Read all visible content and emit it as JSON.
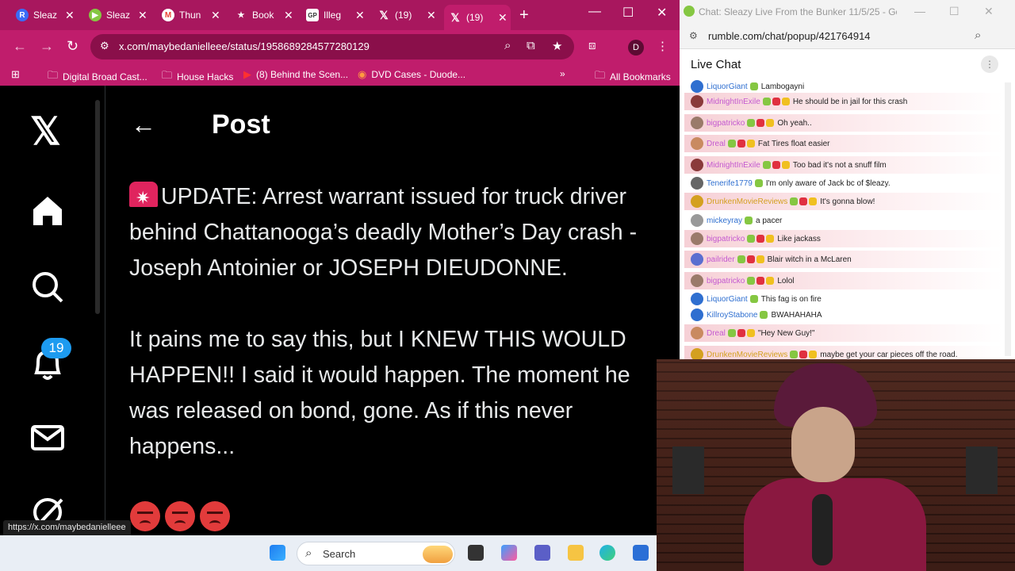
{
  "browser": {
    "tabs": [
      {
        "label": "Sleaz",
        "fav": "R",
        "fav_color": "#3b6cf6"
      },
      {
        "label": "Sleaz",
        "fav": "▶",
        "fav_color": "#85c742"
      },
      {
        "label": "Thun",
        "fav": "M",
        "fav_color": "#ea4335"
      },
      {
        "label": "Book",
        "fav": "★",
        "fav_color": "#a8175e"
      },
      {
        "label": "Illeg",
        "fav": "GP",
        "fav_color": "#ffffff"
      },
      {
        "label": "(19)",
        "fav": "𝕏",
        "fav_color": "#000000"
      },
      {
        "label": "(19)",
        "fav": "𝕏",
        "fav_color": "#000000"
      }
    ],
    "url": "x.com/maybedanielleee/status/1958689284577280129",
    "profile_initial": "D",
    "bookmarks": [
      {
        "label": "Digital Broad Cast..."
      },
      {
        "label": "House Hacks"
      },
      {
        "label": "(8) Behind the Scen..."
      },
      {
        "label": "DVD Cases - Duode..."
      }
    ],
    "all_bookmarks": "All Bookmarks",
    "status_url": "https://x.com/maybedanielleee"
  },
  "x": {
    "header_title": "Post",
    "notification_count": "19",
    "paragraph1": "UPDATE: Arrest warrant issued for truck driver behind Chattanooga’s deadly Mother’s Day crash - Joseph Antoinier or JOSEPH DIEUDONNE.",
    "paragraph2": "It pains me to say this, but I KNEW THIS WOULD HAPPEN!! I said it would happen. The moment he was released on bond, gone.  As if this never happens..."
  },
  "taskbar": {
    "search_label": "Search"
  },
  "rumble": {
    "window_title": "Chat: Sleazy Live From the Bunker 11/5/25 - Goog...",
    "url": "rumble.com/chat/popup/421764914",
    "panel_title": "Live Chat",
    "messages": [
      {
        "user": "LiquorGiant",
        "text": "Lambogayni",
        "color": "#2f6fd0",
        "hl": false
      },
      {
        "user": "MidnightInExile",
        "text": "He should be in jail for this crash",
        "color": "#c45ad0",
        "hl": true
      },
      {
        "user": "bigpatricko",
        "text": "Oh yeah..",
        "color": "#c45ad0",
        "hl": true
      },
      {
        "user": "Dreal",
        "text": "Fat Tires float easier",
        "color": "#c45ad0",
        "hl": true
      },
      {
        "user": "MidnightInExile",
        "text": "Too bad it's not a snuff film",
        "color": "#c45ad0",
        "hl": true
      },
      {
        "user": "Tenerife1779",
        "text": "I'm only aware of Jack bc of $leazy.",
        "color": "#2f6fd0",
        "hl": false
      },
      {
        "user": "DrunkenMovieReviews",
        "text": "It's gonna blow!",
        "color": "#d4a020",
        "hl": true
      },
      {
        "user": "mickeyray",
        "text": "a pacer",
        "color": "#2f6fd0",
        "hl": false
      },
      {
        "user": "bigpatricko",
        "text": "Like jackass",
        "color": "#c45ad0",
        "hl": true
      },
      {
        "user": "pailrider",
        "text": "Blair witch in a McLaren",
        "color": "#c45ad0",
        "hl": true
      },
      {
        "user": "bigpatricko",
        "text": "Lolol",
        "color": "#c45ad0",
        "hl": true
      },
      {
        "user": "LiquorGiant",
        "text": "This fag is on fire",
        "color": "#2f6fd0",
        "hl": false
      },
      {
        "user": "KillroyStabone",
        "text": "BWAHAHAHA",
        "color": "#2f6fd0",
        "hl": false
      },
      {
        "user": "Dreal",
        "text": "\"Hey New Guy!\"",
        "color": "#c45ad0",
        "hl": true
      },
      {
        "user": "DrunkenMovieReviews",
        "text": "maybe get your car pieces off the road.",
        "color": "#d4a020",
        "hl": true
      }
    ]
  }
}
